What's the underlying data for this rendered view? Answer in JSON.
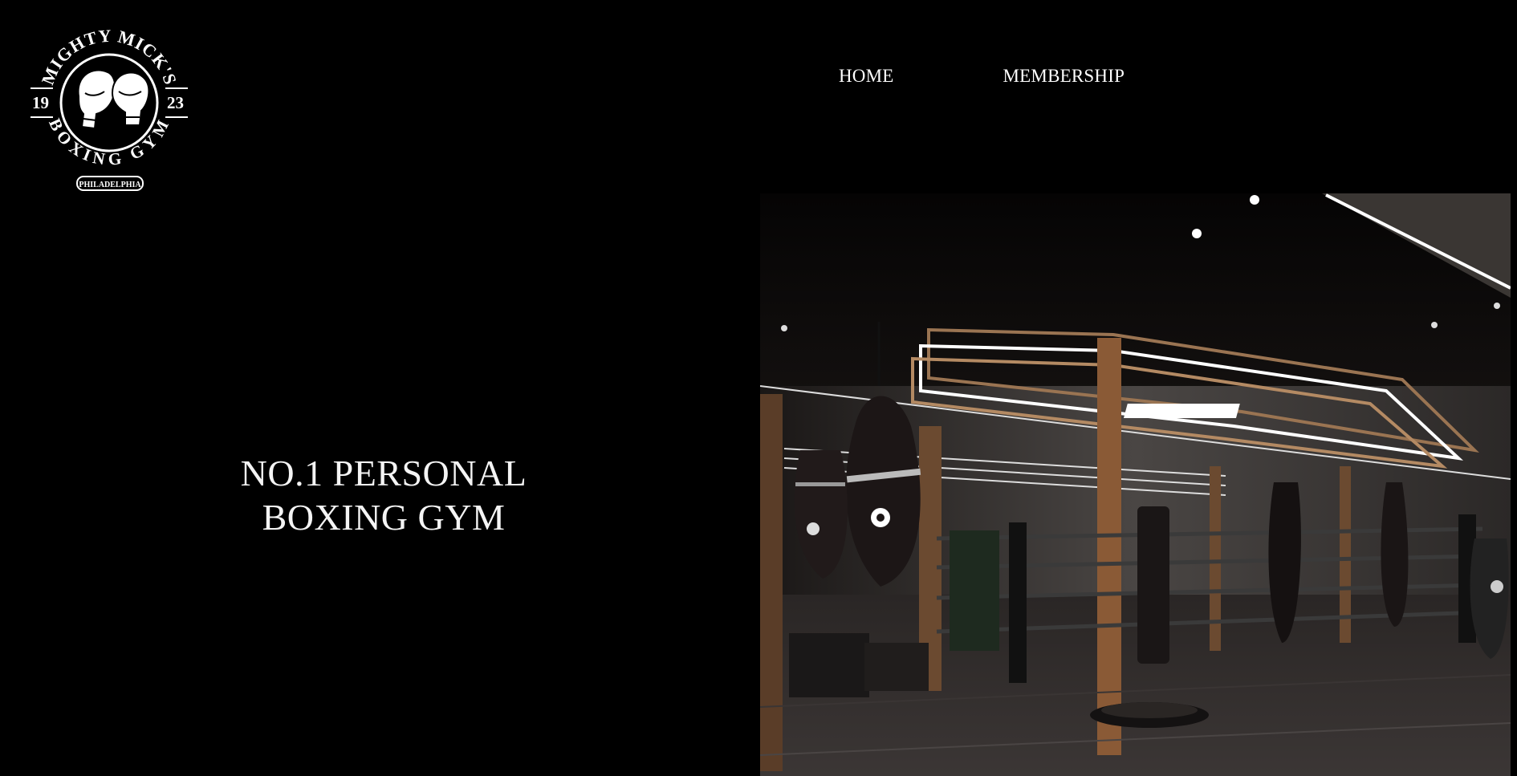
{
  "brand": {
    "top_arc": "MIGHTY MICK'S",
    "bottom_arc": "BOXING GYM",
    "year_left": "19",
    "year_right": "23",
    "city": "PHILADELPHIA",
    "icon": "boxing-gloves-icon"
  },
  "nav": {
    "items": [
      {
        "label": "HOME"
      },
      {
        "label": "MEMBERSHIP"
      }
    ]
  },
  "hero": {
    "title_line1": "NO.1 PERSONAL",
    "title_line2": "BOXING GYM",
    "image": "boxing-gym-interior-photo"
  },
  "colors": {
    "background": "#000000",
    "text": "#ffffff",
    "accent_wood": "#8a5a36"
  }
}
